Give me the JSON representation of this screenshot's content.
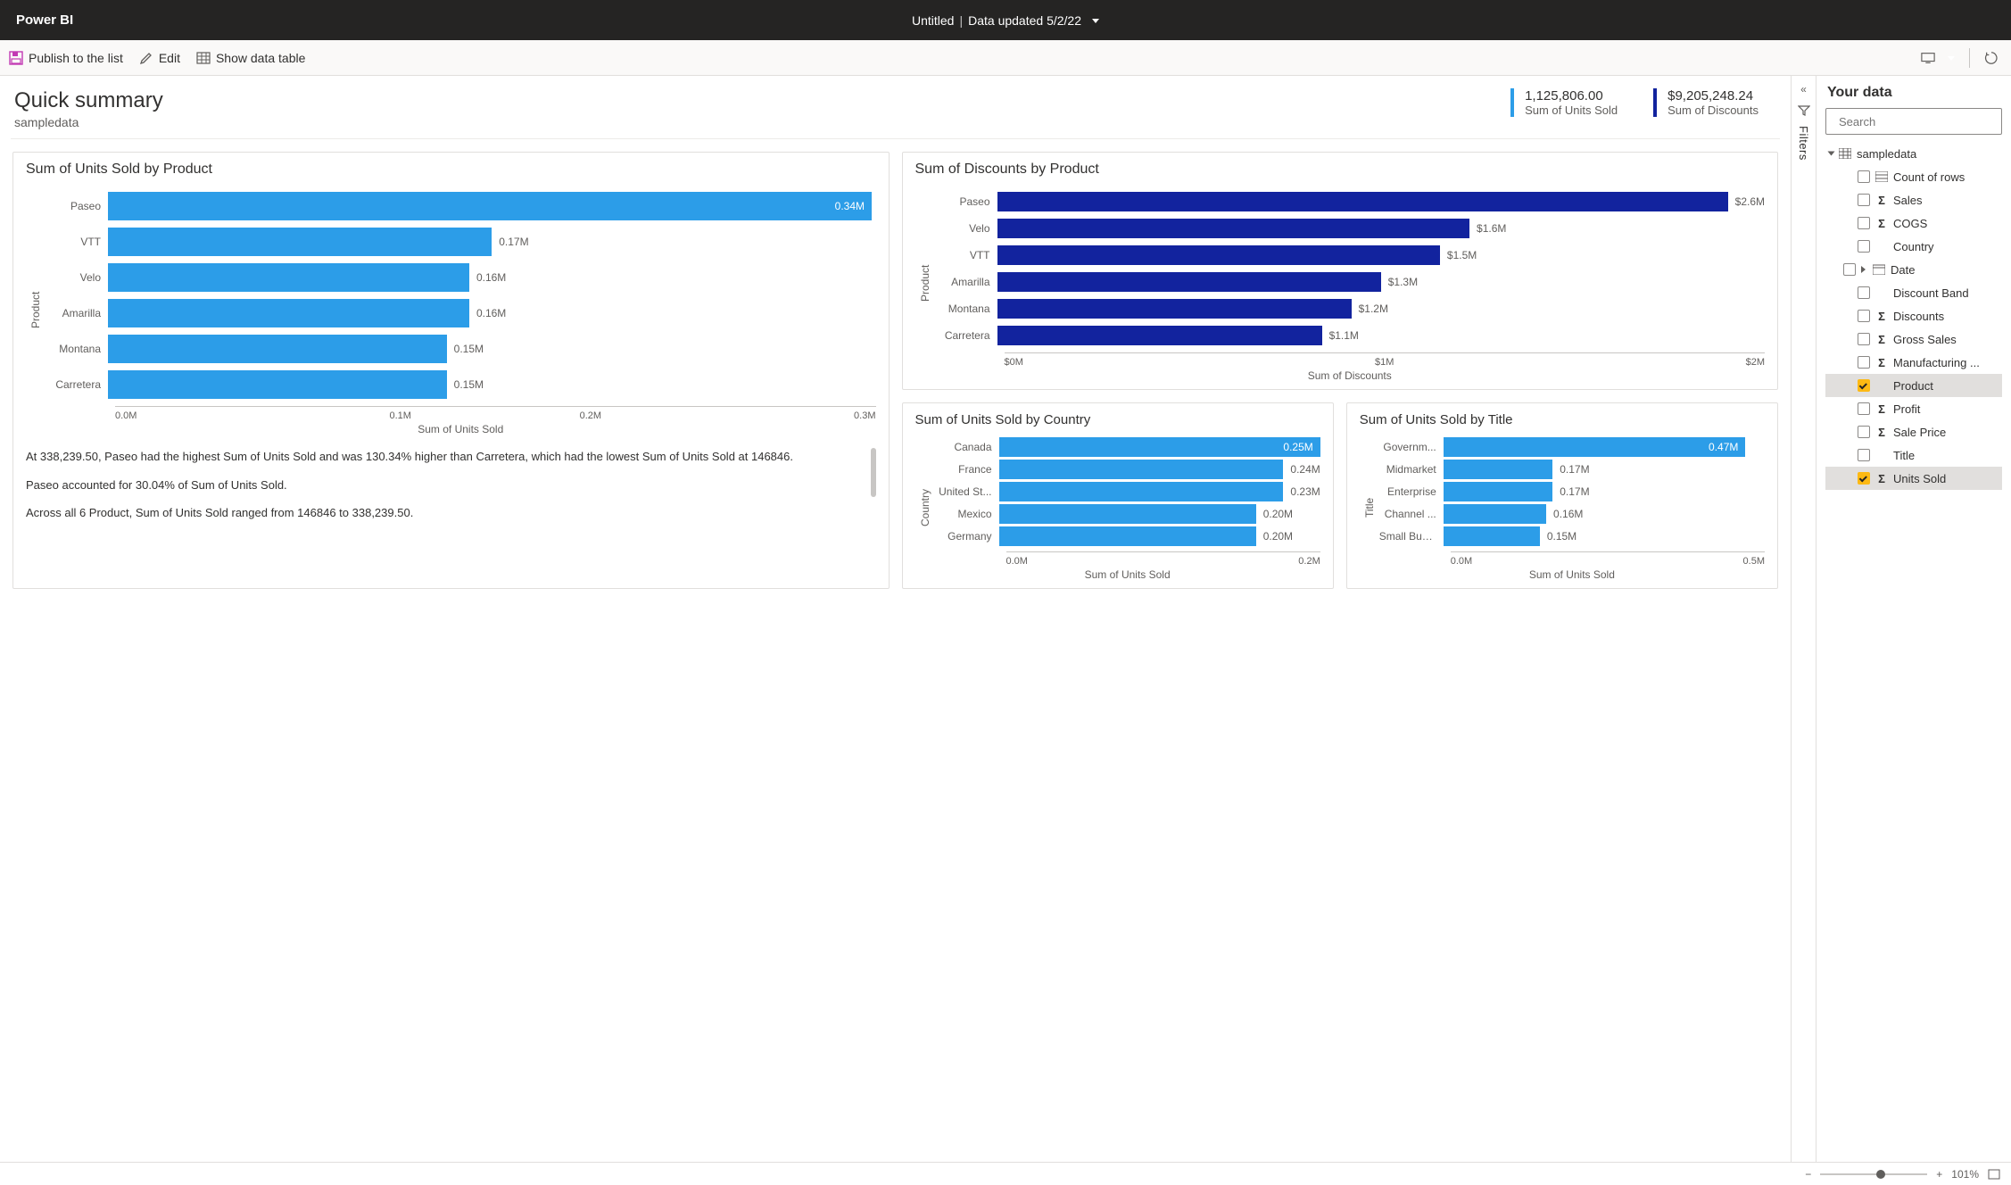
{
  "header": {
    "app_title": "Power BI",
    "doc_title": "Untitled",
    "data_updated_label": "Data updated 5/2/22"
  },
  "toolbar": {
    "publish_label": "Publish to the list",
    "edit_label": "Edit",
    "show_table_label": "Show data table"
  },
  "summary": {
    "title": "Quick summary",
    "subtitle": "sampledata",
    "kpis": [
      {
        "value": "1,125,806.00",
        "label": "Sum of Units Sold",
        "color": "blue"
      },
      {
        "value": "$9,205,248.24",
        "label": "Sum of Discounts",
        "color": "navy"
      }
    ]
  },
  "filters_label": "Filters",
  "chart_data": [
    {
      "id": "units_by_product",
      "type": "bar",
      "orientation": "horizontal",
      "title": "Sum of Units Sold by Product",
      "ylabel": "Product",
      "xlabel": "Sum of Units Sold",
      "categories": [
        "Paseo",
        "VTT",
        "Velo",
        "Amarilla",
        "Montana",
        "Carretera"
      ],
      "values": [
        338239.5,
        170000,
        160000,
        160000,
        150000,
        150000
      ],
      "value_labels": [
        "0.34M",
        "0.17M",
        "0.16M",
        "0.16M",
        "0.15M",
        "0.15M"
      ],
      "x_ticks": [
        "0.0M",
        "0.1M",
        "0.2M",
        "0.3M"
      ],
      "max": 340000,
      "color": "blue",
      "label_inside_first": true
    },
    {
      "id": "discounts_by_product",
      "type": "bar",
      "orientation": "horizontal",
      "title": "Sum of Discounts by Product",
      "ylabel": "Product",
      "xlabel": "Sum of Discounts",
      "categories": [
        "Paseo",
        "Velo",
        "VTT",
        "Amarilla",
        "Montana",
        "Carretera"
      ],
      "values": [
        2600000,
        1600000,
        1500000,
        1300000,
        1200000,
        1100000
      ],
      "value_labels": [
        "$2.6M",
        "$1.6M",
        "$1.5M",
        "$1.3M",
        "$1.2M",
        "$1.1M"
      ],
      "x_ticks": [
        "$0M",
        "$1M",
        "$2M"
      ],
      "max": 2600000,
      "color": "navy",
      "label_inside_first": false
    },
    {
      "id": "units_by_country",
      "type": "bar",
      "orientation": "horizontal",
      "title": "Sum of Units Sold by Country",
      "ylabel": "Country",
      "xlabel": "Sum of Units Sold",
      "categories": [
        "Canada",
        "France",
        "United St...",
        "Mexico",
        "Germany"
      ],
      "values": [
        250000,
        240000,
        230000,
        200000,
        200000
      ],
      "value_labels": [
        "0.25M",
        "0.24M",
        "0.23M",
        "0.20M",
        "0.20M"
      ],
      "x_ticks": [
        "0.0M",
        "0.2M"
      ],
      "max": 250000,
      "color": "blue",
      "label_inside_first": true
    },
    {
      "id": "units_by_title",
      "type": "bar",
      "orientation": "horizontal",
      "title": "Sum of Units Sold by Title",
      "ylabel": "Title",
      "xlabel": "Sum of Units Sold",
      "categories": [
        "Governm...",
        "Midmarket",
        "Enterprise",
        "Channel ...",
        "Small Bus..."
      ],
      "values": [
        470000,
        170000,
        170000,
        160000,
        150000
      ],
      "value_labels": [
        "0.47M",
        "0.17M",
        "0.17M",
        "0.16M",
        "0.15M"
      ],
      "x_ticks": [
        "0.0M",
        "0.5M"
      ],
      "max": 500000,
      "color": "blue",
      "label_inside_first": true
    }
  ],
  "insights": [
    "At 338,239.50, Paseo had the highest Sum of Units Sold and was 130.34% higher than Carretera, which had the lowest Sum of Units Sold at 146846.",
    "Paseo accounted for 30.04% of Sum of Units Sold.",
    "Across all 6 Product, Sum of Units Sold ranged from 146846 to 338,239.50."
  ],
  "data_panel": {
    "title": "Your data",
    "search_placeholder": "Search",
    "table_name": "sampledata",
    "fields": [
      {
        "label": "Count of rows",
        "icon": "table",
        "checked": false
      },
      {
        "label": "Sales",
        "icon": "sigma",
        "checked": false
      },
      {
        "label": "COGS",
        "icon": "sigma",
        "checked": false
      },
      {
        "label": "Country",
        "icon": "",
        "checked": false
      },
      {
        "label": "Date",
        "icon": "table",
        "checked": false,
        "expandable": true
      },
      {
        "label": "Discount Band",
        "icon": "",
        "checked": false
      },
      {
        "label": "Discounts",
        "icon": "sigma",
        "checked": false
      },
      {
        "label": "Gross Sales",
        "icon": "sigma",
        "checked": false
      },
      {
        "label": "Manufacturing ...",
        "icon": "sigma",
        "checked": false
      },
      {
        "label": "Product",
        "icon": "",
        "checked": true,
        "highlight": true
      },
      {
        "label": "Profit",
        "icon": "sigma",
        "checked": false
      },
      {
        "label": "Sale Price",
        "icon": "sigma",
        "checked": false
      },
      {
        "label": "Title",
        "icon": "",
        "checked": false
      },
      {
        "label": "Units Sold",
        "icon": "sigma",
        "checked": true,
        "highlight": true
      }
    ]
  },
  "footer": {
    "zoom": "101%"
  }
}
